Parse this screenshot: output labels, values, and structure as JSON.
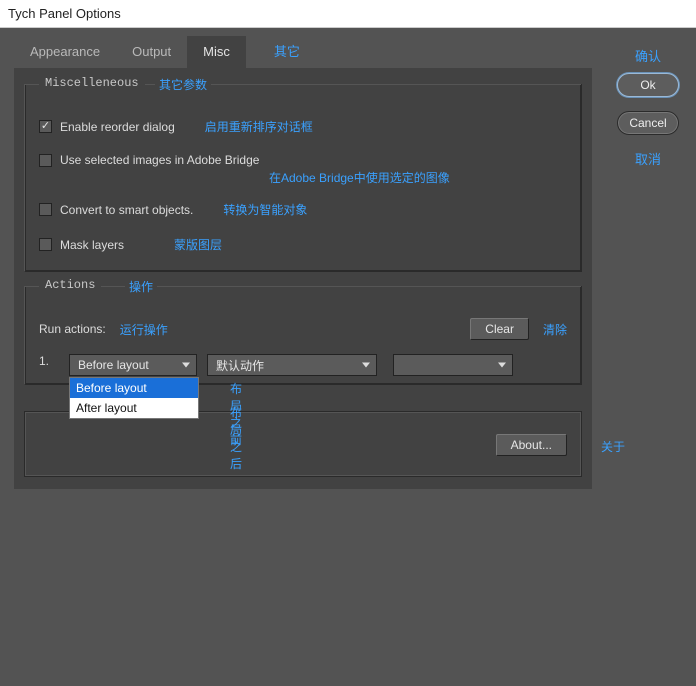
{
  "window": {
    "title": "Tych Panel Options"
  },
  "tabs": {
    "appearance": "Appearance",
    "output": "Output",
    "misc": "Misc",
    "misc_annot": "其它"
  },
  "misc_group": {
    "legend": "Miscelleneous",
    "legend_annot": "其它参数",
    "reorder": {
      "label": "Enable reorder dialog",
      "annot": "启用重新排序对话框",
      "checked": true
    },
    "bridge": {
      "label": "Use selected images in Adobe Bridge",
      "annot": "在Adobe Bridge中使用选定的图像",
      "checked": false
    },
    "smart": {
      "label": "Convert to smart objects.",
      "annot": "转换为智能对象",
      "checked": false
    },
    "mask": {
      "label": "Mask layers",
      "annot": "蒙版图层",
      "checked": false
    }
  },
  "actions_group": {
    "legend": "Actions",
    "legend_annot": "操作",
    "run_label": "Run actions:",
    "run_annot": "运行操作",
    "clear_label": "Clear",
    "clear_annot": "清除",
    "row_index": "1.",
    "layout_select": {
      "value": "Before layout",
      "options": [
        "Before layout",
        "After layout"
      ],
      "opt_annots": [
        "布局之前",
        "布局之后"
      ]
    },
    "actionset_select": {
      "value": "默认动作"
    },
    "action_select": {
      "value": ""
    }
  },
  "about": {
    "label": "About...",
    "annot": "关于"
  },
  "side": {
    "ok_annot": "确认",
    "ok": "Ok",
    "cancel": "Cancel",
    "cancel_annot": "取消"
  }
}
